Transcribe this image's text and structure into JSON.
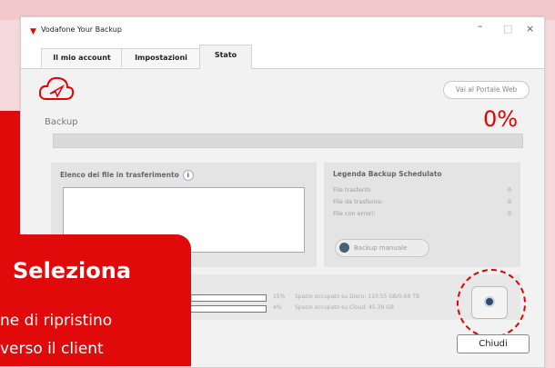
{
  "app": {
    "title": "Vodafone Your Backup",
    "window_controls": {
      "minimize": "–",
      "maximize": "□",
      "close": "×"
    }
  },
  "tabs": [
    {
      "label": "Il mio account"
    },
    {
      "label": "Impostazioni"
    },
    {
      "label": "Stato"
    }
  ],
  "header": {
    "portal_button": "Vai al Portale Web",
    "logo_icon": "cloud-icon"
  },
  "backup": {
    "label": "Backup",
    "percent": "0%",
    "progress": 0
  },
  "files_panel": {
    "title": "Elenco dei file in trasferimento",
    "info_icon": "i"
  },
  "legend_panel": {
    "title": "Legenda Backup Schedulato",
    "rows": [
      {
        "label": "File trasferiti:",
        "value": "0"
      },
      {
        "label": "File da trasferire:",
        "value": "0"
      },
      {
        "label": "File con errori:",
        "value": "0"
      }
    ],
    "manual_button": "Backup manuale"
  },
  "storage": {
    "disk": {
      "percent": "15%",
      "text": "Spazio occupato su Disco: 110.55 GB/0,69 TB",
      "fill": 0.15
    },
    "cloud": {
      "percent": "4%",
      "text": "Spazio occupato su Cloud: 45.39 GB",
      "fill": 0.04
    }
  },
  "footer": {
    "close_button": "Chiudi"
  },
  "overlay": {
    "heading": "Seleziona",
    "line1": "ne di ripristino",
    "line2": "verso il client"
  },
  "colors": {
    "accent": "#e60000",
    "overlay": "#e10a0a"
  }
}
